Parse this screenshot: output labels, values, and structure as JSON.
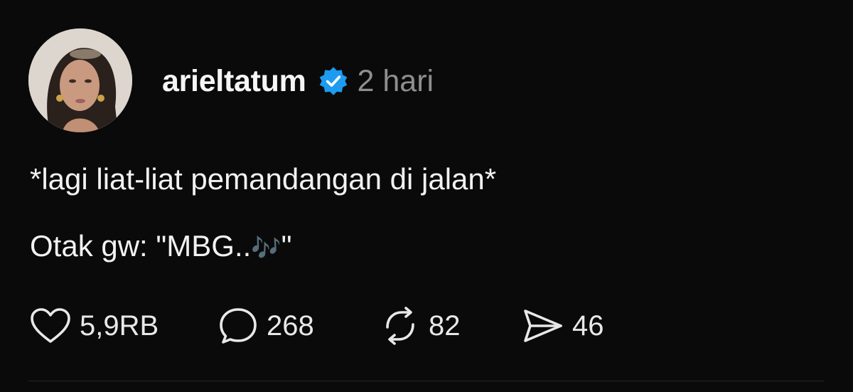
{
  "post": {
    "username": "arieltatum",
    "verified": true,
    "time": "2 hari",
    "text_line1": "*lagi liat-liat pemandangan di jalan*",
    "text_line2_main": "Otak gw: \"MBG..",
    "text_line2_emoji": "🎶",
    "text_line2_end": "\""
  },
  "actions": {
    "like_count": "5,9RB",
    "comment_count": "268",
    "repost_count": "82",
    "share_count": "46"
  },
  "icons": {
    "like": "heart-icon",
    "comment": "comment-bubble-icon",
    "repost": "repost-icon",
    "share": "send-icon",
    "verified": "verified-badge-icon"
  },
  "colors": {
    "background": "#0a0a0a",
    "text": "#f2f2f2",
    "muted": "#8e8e8e",
    "verified": "#1d9bf0"
  }
}
